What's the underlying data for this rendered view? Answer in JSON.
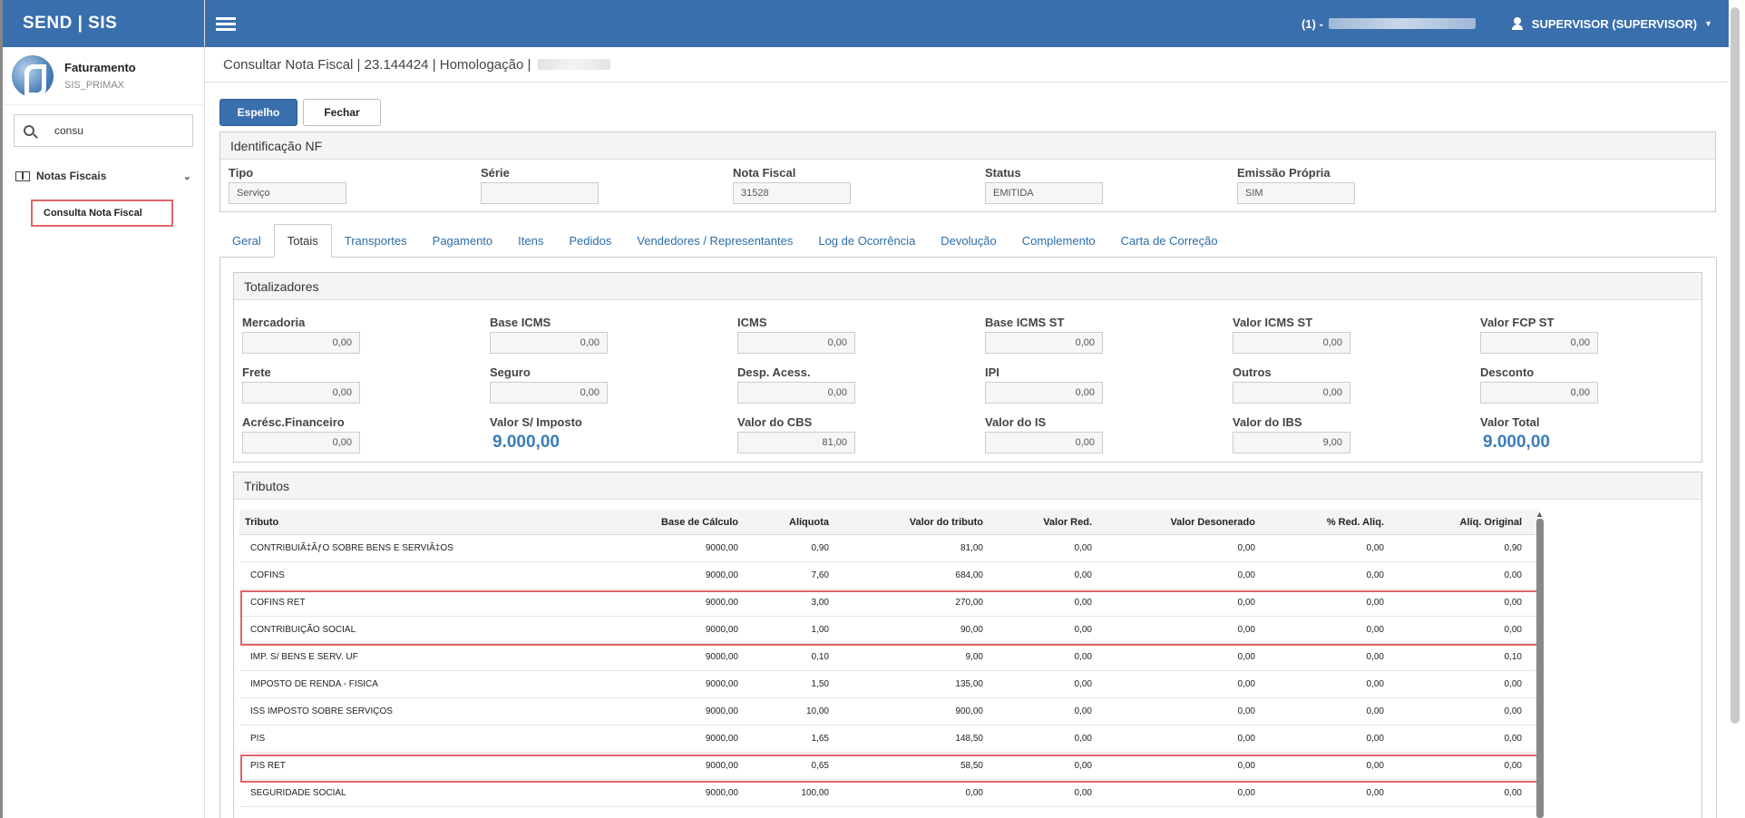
{
  "brand": "SEND | SIS",
  "profile": {
    "app": "Faturamento",
    "sub": "SIS_PRIMAX"
  },
  "search": {
    "value": "consu"
  },
  "menu": {
    "group": "Notas Fiscais",
    "item": "Consulta Nota Fiscal"
  },
  "topbar": {
    "env_prefix": "(1) -",
    "user": "SUPERVISOR (SUPERVISOR)"
  },
  "page": {
    "title": "Consultar Nota Fiscal | 23.144424 | Homologação |"
  },
  "buttons": {
    "espelho": "Espelho",
    "fechar": "Fechar"
  },
  "identificacao": {
    "title": "Identificação NF",
    "fields": [
      {
        "label": "Tipo",
        "value": "Serviço"
      },
      {
        "label": "Série",
        "value": ""
      },
      {
        "label": "Nota Fiscal",
        "value": "31528"
      },
      {
        "label": "Status",
        "value": "EMITIDA"
      },
      {
        "label": "Emissão Própria",
        "value": "SIM"
      }
    ]
  },
  "tabs": [
    "Geral",
    "Totais",
    "Transportes",
    "Pagamento",
    "Itens",
    "Pedidos",
    "Vendedores / Representantes",
    "Log de Ocorrência",
    "Devolução",
    "Complemento",
    "Carta de Correção"
  ],
  "active_tab": "Totais",
  "totalizadores": {
    "title": "Totalizadores",
    "rows": [
      [
        {
          "label": "Mercadoria",
          "value": "0,00"
        },
        {
          "label": "Base ICMS",
          "value": "0,00"
        },
        {
          "label": "ICMS",
          "value": "0,00"
        },
        {
          "label": "Base ICMS ST",
          "value": "0,00"
        },
        {
          "label": "Valor ICMS ST",
          "value": "0,00"
        },
        {
          "label": "Valor FCP ST",
          "value": "0,00"
        }
      ],
      [
        {
          "label": "Frete",
          "value": "0,00"
        },
        {
          "label": "Seguro",
          "value": "0,00"
        },
        {
          "label": "Desp. Acess.",
          "value": "0,00"
        },
        {
          "label": "IPI",
          "value": "0,00"
        },
        {
          "label": "Outros",
          "value": "0,00"
        },
        {
          "label": "Desconto",
          "value": "0,00"
        }
      ],
      [
        {
          "label": "Acrésc.Financeiro",
          "value": "0,00"
        },
        {
          "label": "Valor S/ Imposto",
          "value": "9.000,00",
          "big": true
        },
        {
          "label": "Valor do CBS",
          "value": "81,00"
        },
        {
          "label": "Valor do IS",
          "value": "0,00"
        },
        {
          "label": "Valor do IBS",
          "value": "9,00"
        },
        {
          "label": "Valor Total",
          "value": "9.000,00",
          "big": true
        }
      ]
    ]
  },
  "tributos": {
    "title": "Tributos",
    "columns": [
      "Tributo",
      "Base de Cálculo",
      "Alíquota",
      "Valor do tributo",
      "Valor Red.",
      "Valor Desonerado",
      "% Red. Aliq.",
      "Alíq. Original"
    ],
    "rows": [
      [
        "CONTRIBUIÃ‡ÃƒO SOBRE BENS E SERVIÃ‡OS",
        "9000,00",
        "0,90",
        "81,00",
        "0,00",
        "0,00",
        "0,00",
        "0,90"
      ],
      [
        "COFINS",
        "9000,00",
        "7,60",
        "684,00",
        "0,00",
        "0,00",
        "0,00",
        "0,00"
      ],
      [
        "COFINS RET",
        "9000,00",
        "3,00",
        "270,00",
        "0,00",
        "0,00",
        "0,00",
        "0,00"
      ],
      [
        "CONTRIBUIÇÃO SOCIAL",
        "9000,00",
        "1,00",
        "90,00",
        "0,00",
        "0,00",
        "0,00",
        "0,00"
      ],
      [
        "IMP. S/ BENS E SERV. UF",
        "9000,00",
        "0,10",
        "9,00",
        "0,00",
        "0,00",
        "0,00",
        "0,10"
      ],
      [
        "IMPOSTO DE RENDA - FISICA",
        "9000,00",
        "1,50",
        "135,00",
        "0,00",
        "0,00",
        "0,00",
        "0,00"
      ],
      [
        "ISS IMPOSTO SOBRE SERVIÇOS",
        "9000,00",
        "10,00",
        "900,00",
        "0,00",
        "0,00",
        "0,00",
        "0,00"
      ],
      [
        "PIS",
        "9000,00",
        "1,65",
        "148,50",
        "0,00",
        "0,00",
        "0,00",
        "0,00"
      ],
      [
        "PIS RET",
        "9000,00",
        "0,65",
        "58,50",
        "0,00",
        "0,00",
        "0,00",
        "0,00"
      ],
      [
        "SEGURIDADE SOCIAL",
        "9000,00",
        "100,00",
        "0,00",
        "0,00",
        "0,00",
        "0,00",
        "0,00"
      ]
    ]
  },
  "colors": {
    "primary": "#3a6fad",
    "highlight": "#e0666b",
    "big_value": "#3a7db8"
  }
}
